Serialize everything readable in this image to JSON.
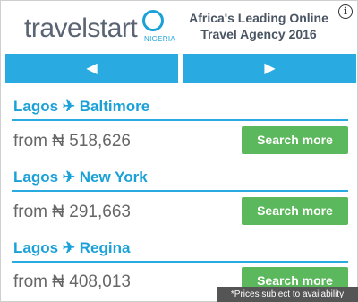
{
  "brand": {
    "name": "travelstart",
    "country": "NIGERIA",
    "tagline_line1": "Africa's Leading Online",
    "tagline_line2": "Travel Agency 2016"
  },
  "info_glyph": "i",
  "nav": {
    "prev_glyph": "◀",
    "next_glyph": "▶"
  },
  "routes": [
    {
      "label": "Lagos ✈ Baltimore",
      "price": "from ₦ 518,626",
      "button": "Search more"
    },
    {
      "label": "Lagos ✈ New York",
      "price": "from ₦ 291,663",
      "button": "Search more"
    },
    {
      "label": "Lagos ✈ Regina",
      "price": "from ₦ 408,013",
      "button": "Search more"
    }
  ],
  "disclaimer": "*Prices subject to availability",
  "colors": {
    "accent": "#29abe2",
    "button": "#5cb85c",
    "text": "#666666"
  }
}
